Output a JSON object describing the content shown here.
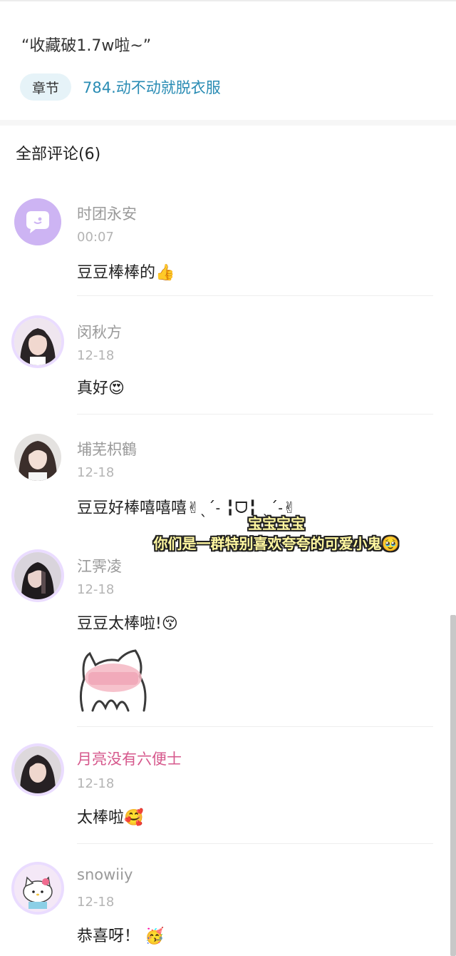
{
  "post": {
    "quote": "“收藏破1.7w啦~”",
    "chapter_label": "章节",
    "chapter_title": "784.动不动就脱衣服"
  },
  "comments_header": "全部评论(6)",
  "comments": [
    {
      "name": "时团永安",
      "time": "00:07",
      "text": "豆豆棒棒的",
      "emoji": "👍",
      "avatar": "chat-bubble-icon"
    },
    {
      "name": "闵秋方",
      "time": "12-18",
      "text": "真好",
      "emoji": "😍",
      "avatar": "user-photo"
    },
    {
      "name": "埔芜枳鶴",
      "time": "12-18",
      "text": "豆豆好棒嘻嘻嘻✌︎ˎˊ˗ ╏ᗜ╏ ˎˊ˗✌︎",
      "emoji": "",
      "avatar": "user-photo"
    },
    {
      "name": "江霁凌",
      "time": "12-18",
      "text": "豆豆太棒啦!",
      "emoji": "😚",
      "avatar": "user-photo"
    },
    {
      "name": "月亮没有六便士",
      "time": "12-18",
      "text": "太棒啦",
      "emoji": "🥰",
      "avatar": "user-photo"
    },
    {
      "name": "snowiiy",
      "time": "12-18",
      "text": "恭喜呀！",
      "emoji": "🥳",
      "avatar": "hello-kitty-avatar"
    }
  ],
  "overlay": {
    "line1": "宝宝宝宝",
    "line2": "你们是一群特别喜欢夸夸的可爱小鬼🥹"
  },
  "colors": {
    "chapter_link": "#2a8cb4",
    "pink_username": "#d6588c",
    "chapter_pill_bg": "#e6f3f8"
  }
}
